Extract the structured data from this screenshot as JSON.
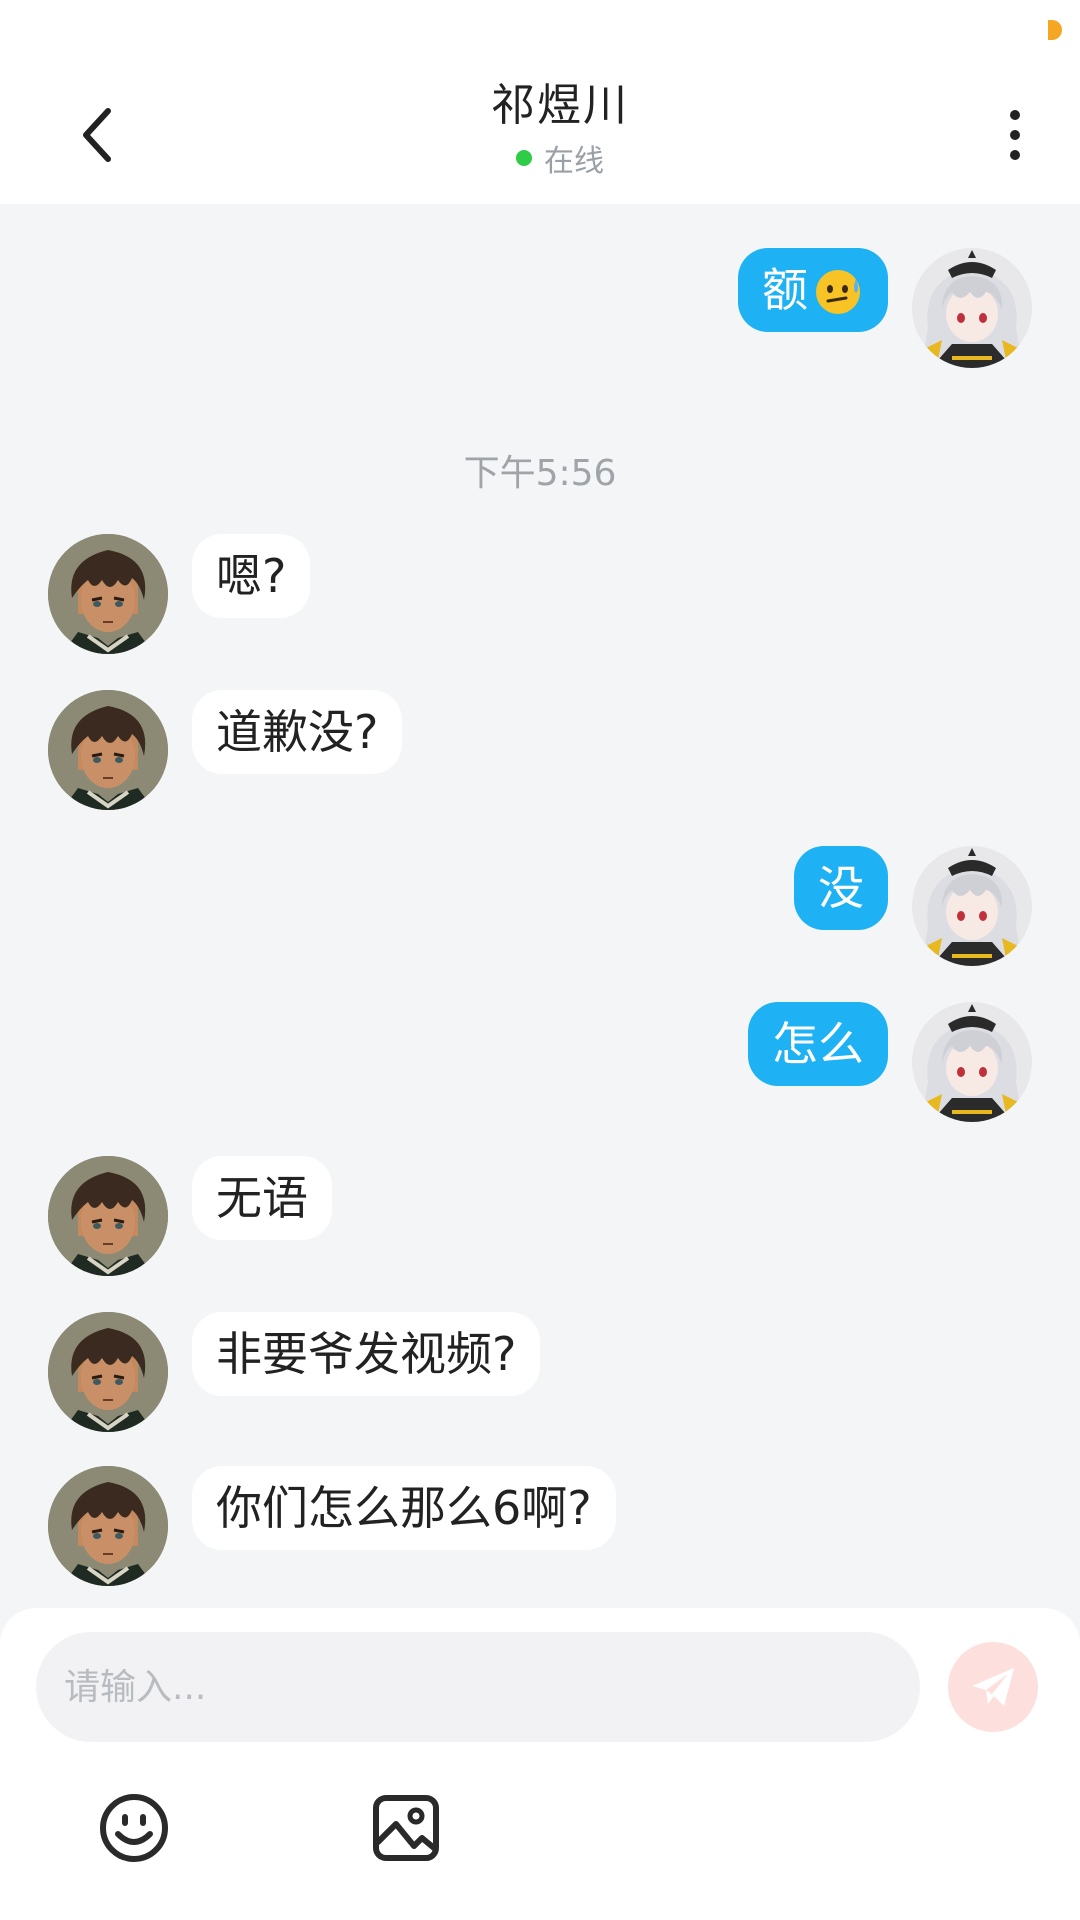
{
  "header": {
    "title": "祁煜川",
    "status": "在线",
    "status_color": "#2ecc47"
  },
  "chat": {
    "timestamp": "下午5:56",
    "messages": [
      {
        "side": "right",
        "text": "额",
        "emoji": "anxious-sweat-face-emoji"
      },
      {
        "side": "left",
        "text": "嗯?"
      },
      {
        "side": "left",
        "text": "道歉没?"
      },
      {
        "side": "right",
        "text": "没"
      },
      {
        "side": "right",
        "text": "怎么"
      },
      {
        "side": "left",
        "text": "无语"
      },
      {
        "side": "left",
        "text": "非要爷发视频?"
      },
      {
        "side": "left",
        "text": "你们怎么那么6啊?"
      }
    ],
    "outgoing_bubble_color": "#1eb2f5",
    "incoming_bubble_color": "#ffffff"
  },
  "input": {
    "placeholder": "请输入..."
  },
  "icons": {
    "back": "chevron-left-icon",
    "more": "more-vertical-icon",
    "send": "paper-plane-icon",
    "emoji": "smiley-icon",
    "image": "image-icon"
  },
  "colors": {
    "accent": "#1eb2f5",
    "send_disabled": "#fde0dd",
    "background": "#f3f5f7"
  }
}
